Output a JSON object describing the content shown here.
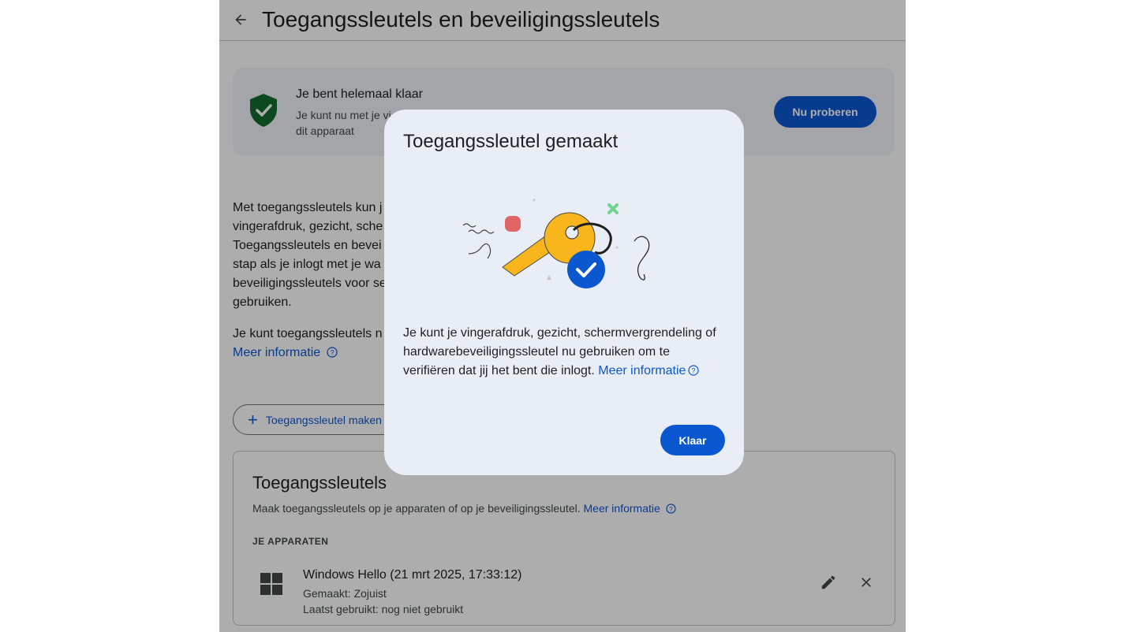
{
  "header": {
    "title": "Toegangssleutels en beveiligingssleutels",
    "back_icon": "arrow-back-icon"
  },
  "banner": {
    "title": "Je bent helemaal klaar",
    "subtitle": "Je kunt nu met je vi… dit apparaat",
    "subtitle_line1": "Je kunt nu met je vi",
    "subtitle_line2": "dit apparaat",
    "button": "Nu proberen",
    "icon": "shield-check-icon"
  },
  "intro": {
    "lines": [
      "Met toegangssleutels kun j",
      "vingerafdruk, gezicht, sche",
      "Toegangssleutels en bevei",
      "stap als je inlogt met je wa",
      "beveiligingssleutels voor se",
      "gebruiken."
    ],
    "line2": "Je kunt toegangssleutels n",
    "link": "Meer informatie"
  },
  "create_button": "Toegangssleutel maken",
  "passkeys_card": {
    "title": "Toegangssleutels",
    "subtitle": "Maak toegangssleutels op je apparaten of op je beveiligingssleutel.",
    "link": "Meer informatie",
    "section": "JE APPARATEN",
    "device": {
      "name": "Windows Hello (21 mrt 2025, 17:33:12)",
      "created": "Gemaakt: Zojuist",
      "last_used": "Laatst gebruikt: nog niet gebruikt"
    }
  },
  "dialog": {
    "title": "Toegangssleutel gemaakt",
    "body": "Je kunt je vingerafdruk, gezicht, schermvergrendeling of hardwarebeveiligingssleutel nu gebruiken om te verifiëren dat jij het bent die inlogt.",
    "link": "Meer informatie",
    "button": "Klaar"
  },
  "colors": {
    "primary": "#0b57d0",
    "shield": "#146c2e",
    "dialog_bg": "#e9eef6",
    "key": "#f9b51c"
  }
}
